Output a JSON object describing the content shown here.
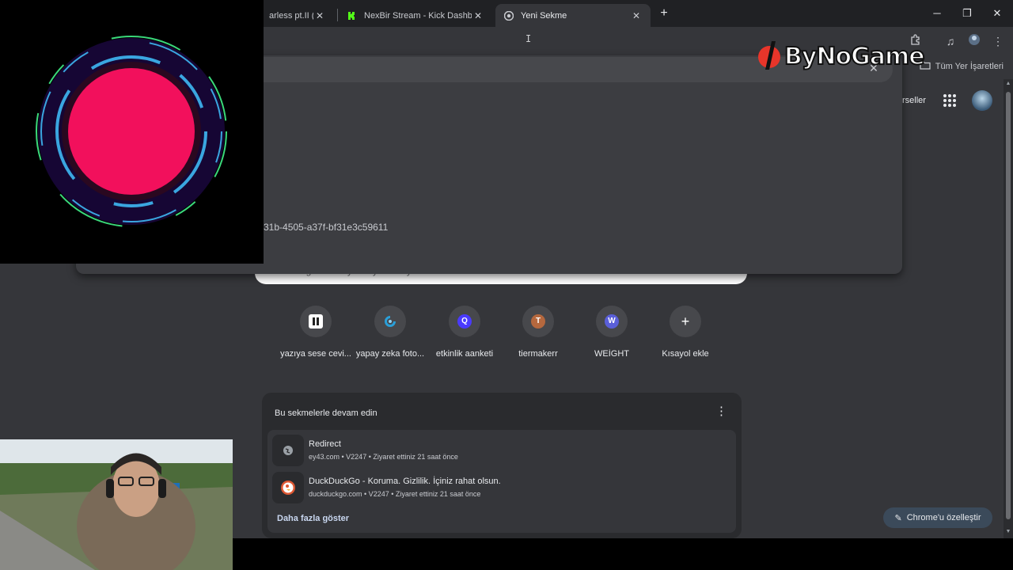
{
  "tabs": [
    {
      "title": "arless pt.II (fea",
      "icon": "none",
      "active": false
    },
    {
      "title": "NexBir Stream - Kick Dashboard",
      "icon": "kick-logo",
      "active": false
    },
    {
      "title": "Yeni Sekme",
      "icon": "chrome-logo",
      "active": true
    }
  ],
  "bookmarks": {
    "all_bookmarks": "Tüm Yer İşaretleri"
  },
  "brand": {
    "name": "ByNoGame"
  },
  "omnibox": {
    "suggestion_fragment": "31b-4505-a37f-bf31e3c59611",
    "search_placeholder": "Google'da arayın veya URL yazın"
  },
  "header": {
    "images_link": "rseller"
  },
  "shortcuts": [
    {
      "label": "yazıya sese cevi...",
      "icon": "pause-icon",
      "letter": "",
      "color": "#ffffff"
    },
    {
      "label": "yapay zeka foto...",
      "icon": "swirl-icon",
      "letter": "",
      "color": "#2a9fd8"
    },
    {
      "label": "etkinlik aanketi",
      "icon": "letter-icon",
      "letter": "Q",
      "color": "#4a3aff"
    },
    {
      "label": "tiermakerr",
      "icon": "letter-icon",
      "letter": "T",
      "color": "#b5683e"
    },
    {
      "label": "WEİGHT",
      "icon": "letter-icon",
      "letter": "W",
      "color": "#5a5fd8"
    },
    {
      "label": "Kısayol ekle",
      "icon": "plus-icon",
      "letter": "+",
      "color": ""
    }
  ],
  "continue_card": {
    "title": "Bu sekmelerle devam edin",
    "items": [
      {
        "title": "Redirect",
        "meta": "ey43.com • V2247 • Ziyaret ettiniz 21 saat önce",
        "icon": "globe-icon"
      },
      {
        "title": "DuckDuckGo - Koruma. Gizlilik. İçiniz rahat olsun.",
        "meta": "duckduckgo.com • V2247 • Ziyaret ettiniz 21 saat önce",
        "icon": "duckduckgo-icon"
      }
    ],
    "more": "Daha fazla göster"
  },
  "customize": {
    "label": "Chrome'u özelleştir"
  },
  "colors": {
    "accent_pink": "#f2105c",
    "ring_blue": "#3aa6e0",
    "ring_green": "#3ad87a",
    "page_bg": "#35363a"
  }
}
